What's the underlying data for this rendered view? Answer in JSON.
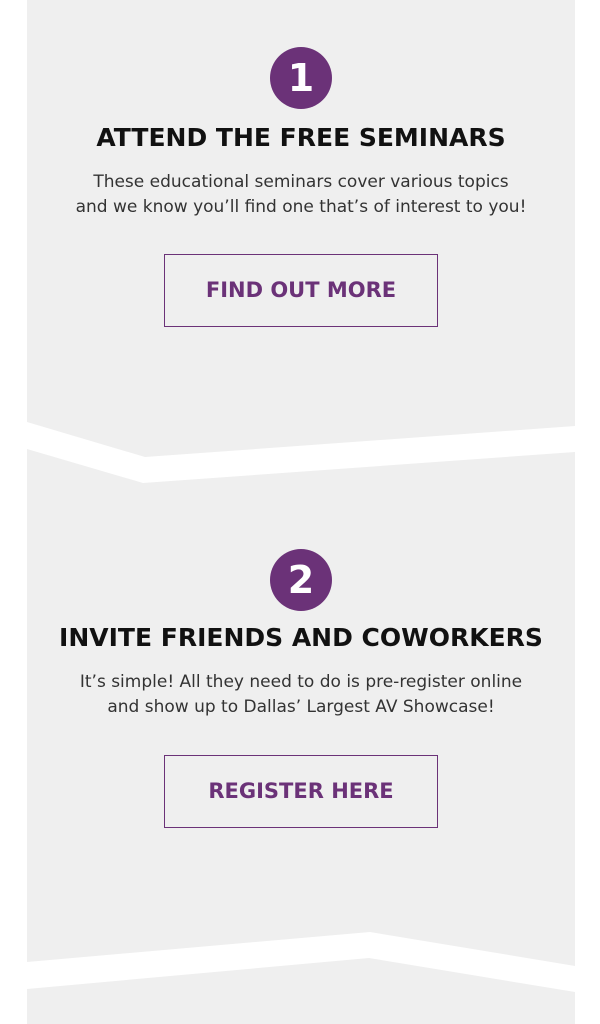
{
  "colors": {
    "accent": "#6b3278",
    "panel": "#efefef",
    "title": "#111111",
    "text": "#333333"
  },
  "steps": [
    {
      "number": "1",
      "title": "ATTEND THE FREE SEMINARS",
      "description_lines": [
        "These educational seminars cover various topics",
        "and we know you’ll find one that’s of interest to you!"
      ],
      "button_label": "FIND OUT MORE"
    },
    {
      "number": "2",
      "title": "INVITE FRIENDS AND COWORKERS",
      "description_lines": [
        "It’s simple! All they need to do is pre-register online",
        "and show up to Dallas’ Largest AV Showcase!"
      ],
      "button_label": "REGISTER HERE"
    }
  ]
}
